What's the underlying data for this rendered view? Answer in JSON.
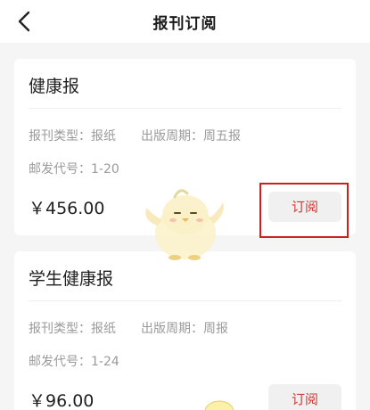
{
  "header": {
    "title": "报刊订阅",
    "back_icon": "chevron-left-icon"
  },
  "colors": {
    "accent": "#d23a36",
    "highlight": "#cc1f1f",
    "background": "#f5f5f5"
  },
  "subscriptions": [
    {
      "name": "健康报",
      "type": "报刊类型：报纸",
      "cycle": "出版周期：周五报",
      "code": "邮发代号：1-20",
      "price": "￥456.00",
      "button_label": "订阅"
    },
    {
      "name": "学生健康报",
      "type": "报刊类型：报纸",
      "cycle": "出版周期：周报",
      "code": "邮发代号：1-24",
      "price": "￥96.00",
      "button_label": "订阅"
    }
  ]
}
